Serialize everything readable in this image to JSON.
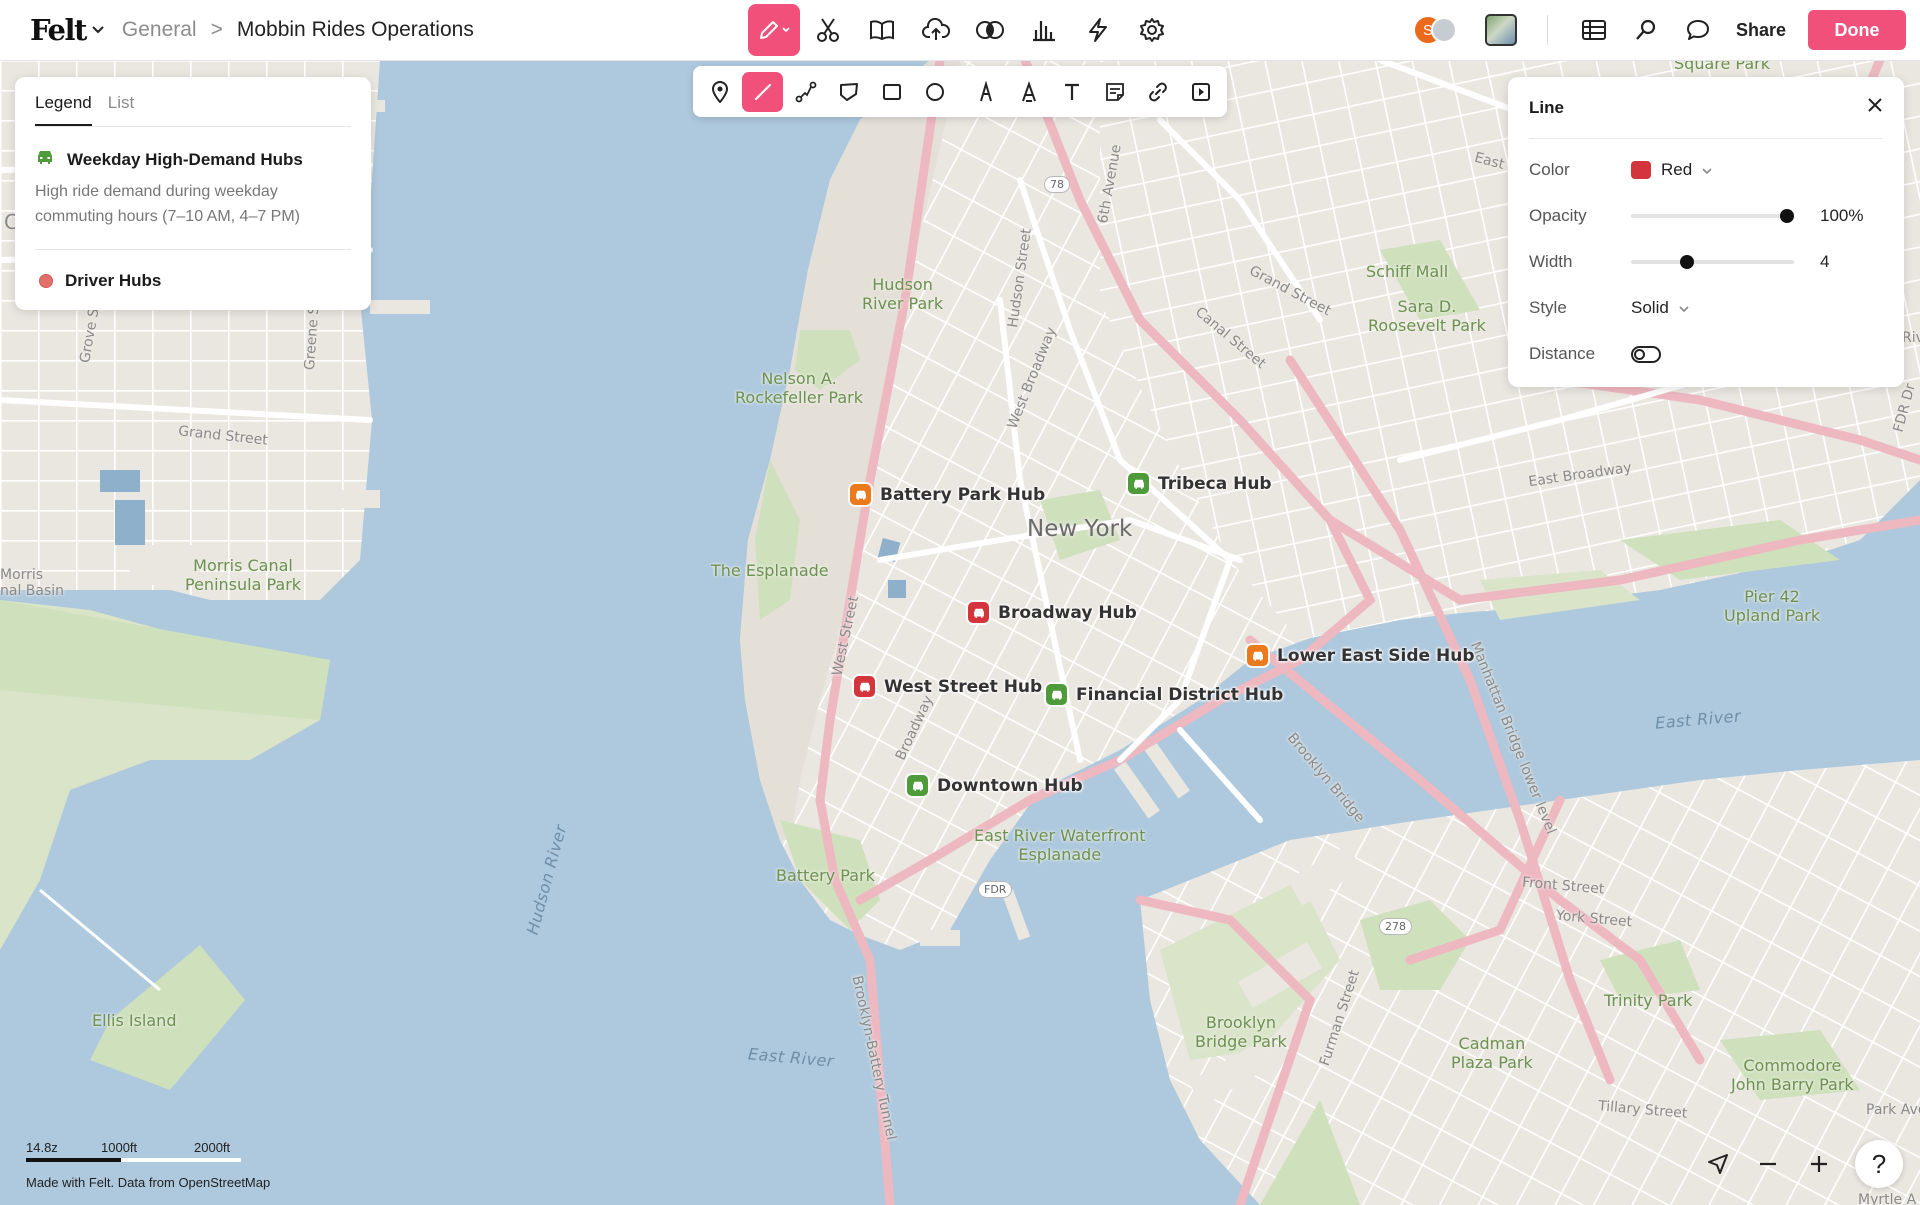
{
  "header": {
    "logo": "Felt",
    "breadcrumb_parent": "General",
    "breadcrumb_separator": ">",
    "project_title": "Mobbin Rides Operations",
    "avatar_initial": "S",
    "share_label": "Share",
    "done_label": "Done",
    "accent_color": "#f0507a"
  },
  "tools": [
    "pencil-icon",
    "scissors-icon",
    "book-icon",
    "upload-cloud-icon",
    "toggle-layers-icon",
    "bar-chart-icon",
    "lightning-icon",
    "gear-icon"
  ],
  "draw_tools": [
    "pin-icon",
    "line-icon",
    "route-icon",
    "polygon-icon",
    "rectangle-icon",
    "circle-icon",
    "marker-icon",
    "highlighter-icon",
    "text-icon",
    "note-icon",
    "link-icon",
    "embed-icon"
  ],
  "legend": {
    "tab_legend": "Legend",
    "tab_list": "List",
    "layer1_title": "Weekday High-Demand Hubs",
    "layer1_desc": "High ride demand during weekday commuting hours (7–10 AM, 4–7 PM)",
    "layer2_title": "Driver Hubs"
  },
  "line_panel": {
    "title": "Line",
    "color_label": "Color",
    "color_value": "Red",
    "color_hex": "#d4353d",
    "opacity_label": "Opacity",
    "opacity_value": "100%",
    "opacity_fraction": 1.0,
    "width_label": "Width",
    "width_value": "4",
    "style_label": "Style",
    "style_value": "Solid",
    "distance_label": "Distance",
    "distance_enabled": false
  },
  "hubs": [
    {
      "name": "Battery Park Hub",
      "color": "#ea7a1c"
    },
    {
      "name": "Tribeca Hub",
      "color": "#4f9a3a"
    },
    {
      "name": "Broadway Hub",
      "color": "#d4353d"
    },
    {
      "name": "Lower East Side Hub",
      "color": "#ea7a1c"
    },
    {
      "name": "West Street Hub",
      "color": "#d4353d"
    },
    {
      "name": "Financial District Hub",
      "color": "#4f9a3a"
    },
    {
      "name": "Downtown Hub",
      "color": "#4f9a3a"
    }
  ],
  "map_labels": {
    "city": "New York",
    "hudson_river_park": "Hudson\nRiver Park",
    "rockefeller_park": "Nelson A.\nRockefeller Park",
    "esplanade": "The Esplanade",
    "morris_canal": "Morris Canal\nPeninsula Park",
    "morris_basin": "Morris\nnal Basin",
    "ellis_island": "Ellis Island",
    "hudson_river": "Hudson River",
    "east_river_1": "East River",
    "east_river_2": "East River",
    "battery_park": "Battery Park",
    "east_river_waterfront": "East River Waterfront\nEsplanade",
    "brooklyn_bridge_park": "Brooklyn\nBridge Park",
    "cadman_plaza": "Cadman\nPlaza Park",
    "trinity_park": "Trinity Park",
    "commodore_park": "Commodore\nJohn Barry Park",
    "pier_42": "Pier 42\nUpland Park",
    "schiff_mall": "Schiff Mall",
    "sara_roosevelt": "Sara D.\nRoosevelt Park",
    "square_park": "Square Park",
    "grand_street_1": "Grand Street",
    "grand_street_2": "Grand Street",
    "canal_street": "Canal Street",
    "east_broadway": "East Broadway",
    "hudson_street": "Hudson Street",
    "west_broadway": "West Broadway",
    "sixth_avenue": "6th Avenue",
    "west_street": "West Street",
    "broadway": "Broadway",
    "brooklyn_bridge": "Brooklyn Bridge",
    "manhattan_bridge": "Manhattan Bridge lower level",
    "brooklyn_battery_tunnel": "Brooklyn-Battery Tunnel",
    "front_street": "Front Street",
    "york_street": "York Street",
    "furman_street": "Furman Street",
    "tillary_street": "Tillary Street",
    "park_ave": "Park Ave",
    "myrtle": "Myrtle A",
    "grove_st": "Grove St",
    "greene_st": "Greene S",
    "east_st": "East S",
    "fdr_dr": "FDR Dr",
    "riv": "Riv",
    "c_edge": "C"
  },
  "shields": [
    "78",
    "FDR",
    "278"
  ],
  "scale": {
    "zoom": "14.8z",
    "mark1": "1000ft",
    "mark2": "2000ft"
  },
  "attribution": "Made with Felt. Data from OpenStreetMap",
  "help_label": "?"
}
